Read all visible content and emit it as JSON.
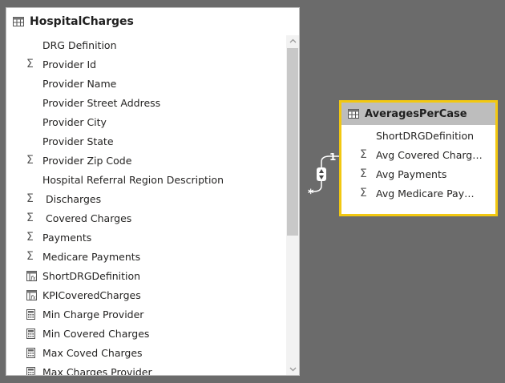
{
  "hospital_charges": {
    "title": "HospitalCharges",
    "fields": [
      {
        "label": "DRG Definition",
        "icon": ""
      },
      {
        "label": "Provider Id",
        "icon": "sigma"
      },
      {
        "label": "Provider Name",
        "icon": ""
      },
      {
        "label": "Provider Street Address",
        "icon": ""
      },
      {
        "label": "Provider City",
        "icon": ""
      },
      {
        "label": "Provider State",
        "icon": ""
      },
      {
        "label": "Provider Zip Code",
        "icon": "sigma"
      },
      {
        "label": "Hospital Referral Region Description",
        "icon": ""
      },
      {
        "label": " Discharges",
        "icon": "sigma"
      },
      {
        "label": " Covered Charges",
        "icon": "sigma"
      },
      {
        "label": "Payments",
        "icon": "sigma"
      },
      {
        "label": "Medicare Payments",
        "icon": "sigma"
      },
      {
        "label": "ShortDRGDefinition",
        "icon": "calculated-column"
      },
      {
        "label": "KPICoveredCharges",
        "icon": "calculated-column"
      },
      {
        "label": "Min Charge Provider",
        "icon": "calculator"
      },
      {
        "label": "Min Covered Charges",
        "icon": "calculator"
      },
      {
        "label": "Max Coved Charges",
        "icon": "calculator"
      },
      {
        "label": "Max Charges Provider",
        "icon": "calculator"
      }
    ]
  },
  "averages_per_case": {
    "title": "AveragesPerCase",
    "fields": [
      {
        "label": "ShortDRGDefinition",
        "icon": ""
      },
      {
        "label": "Avg Covered Charges",
        "icon": "sigma"
      },
      {
        "label": "Avg Payments",
        "icon": "sigma"
      },
      {
        "label": "Avg Medicare Payme...",
        "icon": "sigma"
      }
    ]
  },
  "relationship": {
    "one_side": "1",
    "many_side": "*"
  },
  "colors": {
    "canvas": "#6b6b6b",
    "selected_border": "#f2c811",
    "header_gray": "#bdbdbd"
  }
}
